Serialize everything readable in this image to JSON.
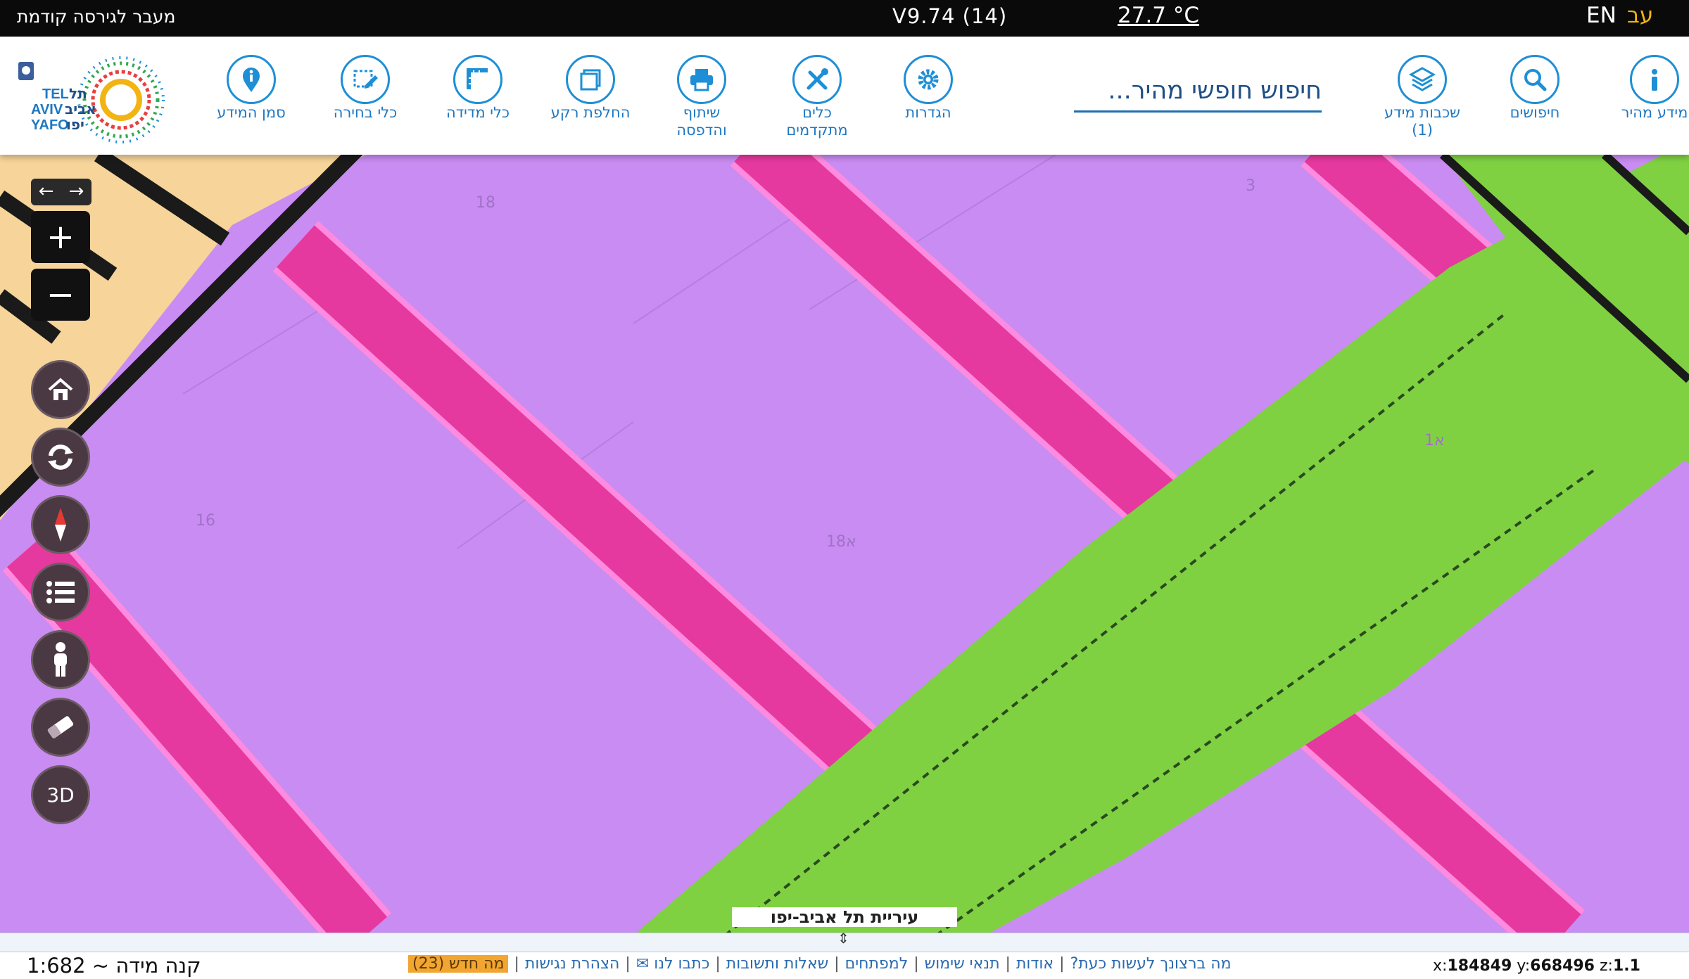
{
  "topbar": {
    "prev_version": "מעבר לגירסה קודמת",
    "version": "V9.74 (14)",
    "temperature": "27.7 °C",
    "lang_en": "EN",
    "lang_he": "עב"
  },
  "toolbar": {
    "items": [
      {
        "label": "מידע מהיר",
        "icon": "info-icon"
      },
      {
        "label": "חיפושים",
        "icon": "search-icon"
      },
      {
        "label": "שכבות מידע",
        "sub": "(1)",
        "icon": "layers-icon"
      },
      {
        "label": "הגדרות",
        "icon": "gear-icon"
      },
      {
        "label": "כלים",
        "sub": "מתקדמים",
        "icon": "tools-icon"
      },
      {
        "label": "שיתוף",
        "sub": "והדפסה",
        "icon": "printer-icon"
      },
      {
        "label": "החלפת רקע",
        "icon": "basemap-icon"
      },
      {
        "label": "כלי מדידה",
        "icon": "ruler-icon"
      },
      {
        "label": "כלי בחירה",
        "icon": "select-icon"
      },
      {
        "label": "סמן המידע",
        "icon": "info-marker-icon"
      }
    ],
    "search_placeholder": "חיפוש חופשי מהיר..."
  },
  "logo": {
    "text_en_1": "TEL",
    "text_en_2": "AVIV",
    "text_en_3": "YAFO",
    "text_he_1": "תל",
    "text_he_2": "אביב",
    "text_he_3": "יפו"
  },
  "map": {
    "parcels": [
      "18",
      "3",
      "1א",
      "16",
      "18א"
    ],
    "city_label": "עיריית תל אביב-יפו",
    "controls": {
      "plus": "+",
      "minus": "−",
      "three_d": "3D"
    }
  },
  "footer": {
    "scale": "קנה מידה ~ 1:682",
    "links": [
      "מה ברצונך לעשות כעת?",
      "אודות",
      "תנאי שימוש",
      "למפתחים",
      "שאלות ותשובות",
      "כתבו לנו ✉",
      "הצהרת נגישות"
    ],
    "news": "מה חדש (23)",
    "coords": {
      "x_label": "x:",
      "x": "184849",
      "y_label": "y:",
      "y": "668496",
      "z_label": "z:",
      "z": "1.1"
    }
  },
  "colors": {
    "accent": "#1e8fd6",
    "parcel": "#c98cf2",
    "road": "#e83fa0",
    "park": "#7fd142",
    "news": "#f2a531"
  }
}
